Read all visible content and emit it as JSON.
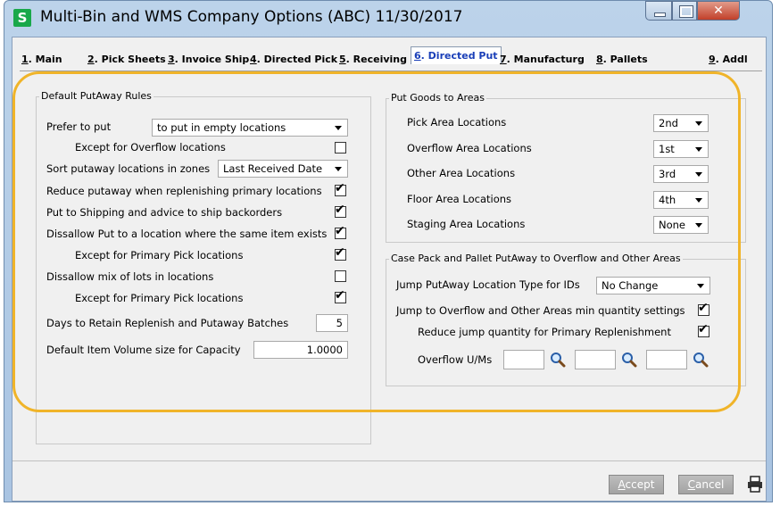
{
  "window": {
    "title": "Multi-Bin and WMS Company Options (ABC) 11/30/2017",
    "app_icon_letter": "S"
  },
  "tabs": [
    {
      "num": "1",
      "label": ". Main"
    },
    {
      "num": "2",
      "label": ". Pick Sheets"
    },
    {
      "num": "3",
      "label": ". Invoice Ship"
    },
    {
      "num": "4",
      "label": ". Directed Pick"
    },
    {
      "num": "5",
      "label": ". Receiving"
    },
    {
      "num": "6",
      "label": ". Directed Put"
    },
    {
      "num": "7",
      "label": ". Manufacturg"
    },
    {
      "num": "8",
      "label": ". Pallets"
    },
    {
      "num": "9",
      "label": ". Addl"
    }
  ],
  "putaway": {
    "group_title": "Default PutAway Rules",
    "prefer_label": "Prefer to put",
    "prefer_value": "to put in empty locations",
    "except_overflow_label": "Except for Overflow locations",
    "except_overflow_checked": false,
    "sort_label": "Sort putaway locations in zones",
    "sort_value": "Last Received Date",
    "reduce_label": "Reduce putaway when replenishing primary locations",
    "reduce_checked": true,
    "ship_label": "Put to Shipping and advice to ship backorders",
    "ship_checked": true,
    "disallow_same_label": "Dissallow Put to a location where the same item exists",
    "disallow_same_checked": true,
    "except_primary1_label": "Except for Primary Pick locations",
    "except_primary1_checked": true,
    "disallow_lots_label": "Dissallow mix of lots in locations",
    "disallow_lots_checked": false,
    "except_primary2_label": "Except for Primary Pick locations",
    "except_primary2_checked": true,
    "days_label": "Days to Retain Replenish and Putaway Batches",
    "days_value": "5",
    "volume_label": "Default Item Volume size for Capacity",
    "volume_value": "1.0000"
  },
  "areas": {
    "group_title": "Put Goods to Areas",
    "rows": [
      {
        "label": "Pick Area Locations",
        "value": "2nd"
      },
      {
        "label": "Overflow Area Locations",
        "value": "1st"
      },
      {
        "label": "Other Area Locations",
        "value": "3rd"
      },
      {
        "label": "Floor Area Locations",
        "value": "4th"
      },
      {
        "label": "Staging Area Locations",
        "value": "None"
      }
    ]
  },
  "casepack": {
    "group_title": "Case Pack and Pallet PutAway to Overflow and Other Areas",
    "jump_type_label": "Jump PutAway Location Type for IDs",
    "jump_type_value": "No Change",
    "jump_overflow_label": "Jump to Overflow and Other Areas min quantity settings",
    "jump_overflow_checked": true,
    "reduce_jump_label": "Reduce jump quantity for Primary Replenishment",
    "reduce_jump_checked": true,
    "overflow_um_label": "Overflow U/Ms"
  },
  "buttons": {
    "accept_u": "A",
    "accept_rest": "ccept",
    "cancel_u": "C",
    "cancel_rest": "ancel"
  },
  "colors": {
    "highlight": "#f0b429",
    "active_tab": "#1a3fb8",
    "app_icon": "#19a84a"
  }
}
